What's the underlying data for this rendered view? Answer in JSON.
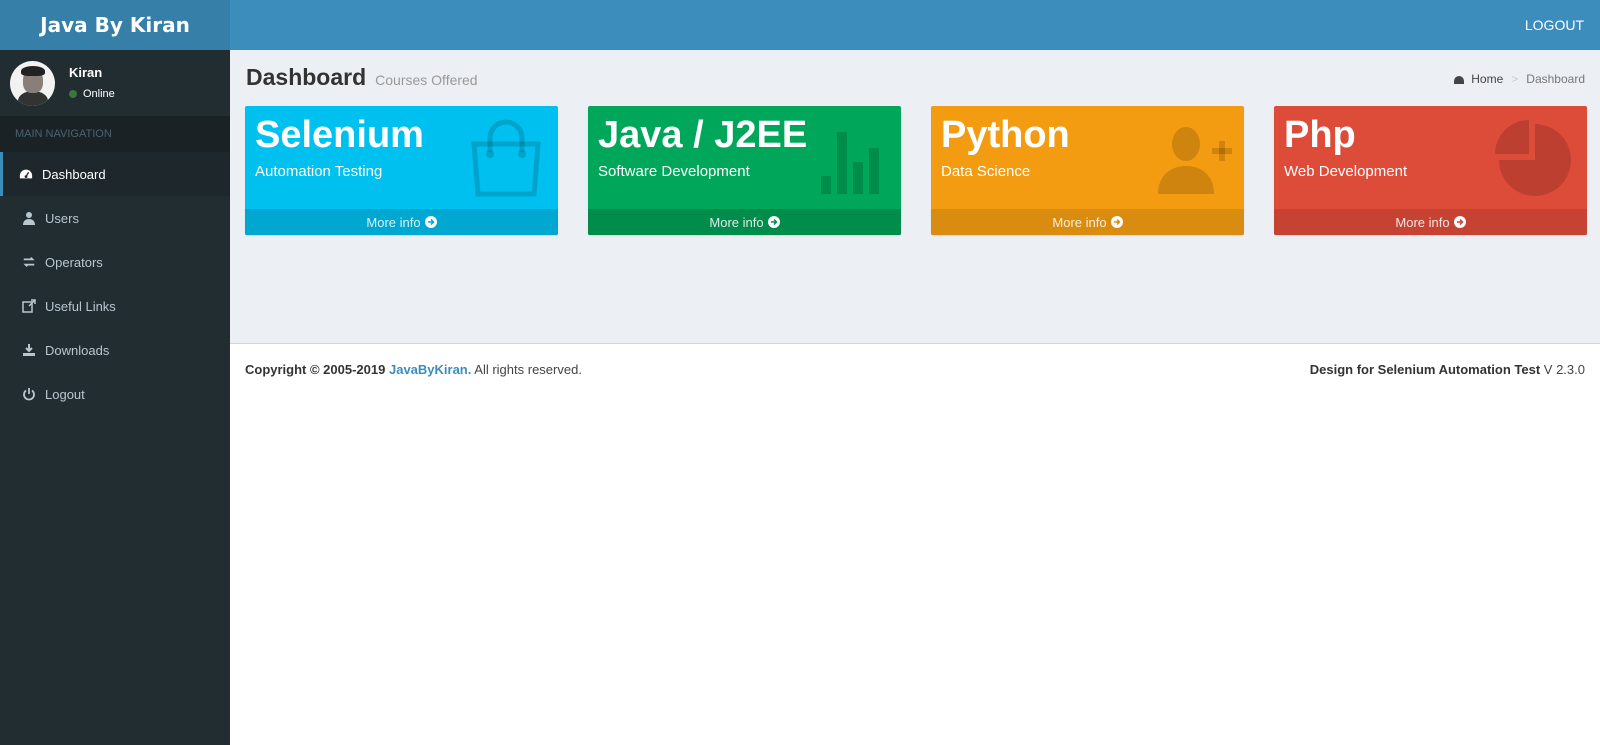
{
  "header": {
    "logo": "Java By Kiran",
    "logout_label": "LOGOUT"
  },
  "sidebar": {
    "user": {
      "name": "Kiran",
      "status": "Online"
    },
    "nav_header": "MAIN NAVIGATION",
    "items": [
      {
        "label": "Dashboard",
        "icon": "dashboard-icon"
      },
      {
        "label": "Users",
        "icon": "user-icon"
      },
      {
        "label": "Operators",
        "icon": "exchange-icon"
      },
      {
        "label": "Useful Links",
        "icon": "external-link-icon"
      },
      {
        "label": "Downloads",
        "icon": "download-icon"
      },
      {
        "label": "Logout",
        "icon": "power-icon"
      }
    ]
  },
  "content": {
    "title": "Dashboard",
    "subtitle": "Courses Offered",
    "breadcrumb": {
      "home": "Home",
      "current": "Dashboard",
      "separator": ">"
    },
    "boxes": [
      {
        "title": "Selenium",
        "subtitle": "Automation Testing",
        "more": "More info",
        "color": "#00c0ef",
        "icon": "shopping-bag-icon"
      },
      {
        "title": "Java / J2EE",
        "subtitle": "Software Development",
        "more": "More info",
        "color": "#00a65a",
        "icon": "bar-chart-icon"
      },
      {
        "title": "Python",
        "subtitle": "Data Science",
        "more": "More info",
        "color": "#f39c12",
        "icon": "user-plus-icon"
      },
      {
        "title": "Php",
        "subtitle": "Web Development",
        "more": "More info",
        "color": "#dd4b39",
        "icon": "pie-chart-icon"
      }
    ]
  },
  "footer": {
    "copyright_prefix": "Copyright © 2005-2019",
    "brand": "JavaByKiran.",
    "rights": "All rights reserved.",
    "design": "Design for Selenium Automation Test",
    "version": "V 2.3.0"
  }
}
